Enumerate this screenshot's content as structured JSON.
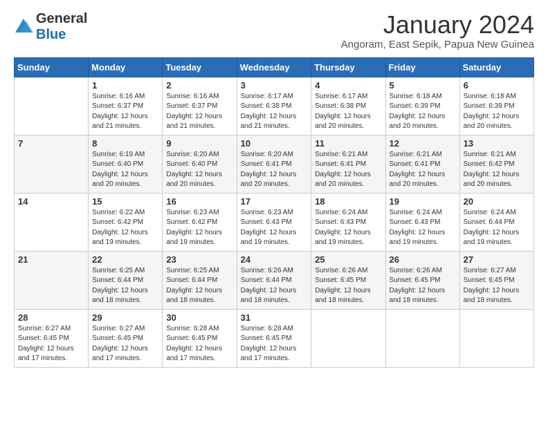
{
  "header": {
    "logo_general": "General",
    "logo_blue": "Blue",
    "main_title": "January 2024",
    "subtitle": "Angoram, East Sepik, Papua New Guinea"
  },
  "calendar": {
    "days_of_week": [
      "Sunday",
      "Monday",
      "Tuesday",
      "Wednesday",
      "Thursday",
      "Friday",
      "Saturday"
    ],
    "weeks": [
      [
        {
          "day": "",
          "info": ""
        },
        {
          "day": "1",
          "info": "Sunrise: 6:16 AM\nSunset: 6:37 PM\nDaylight: 12 hours\nand 21 minutes."
        },
        {
          "day": "2",
          "info": "Sunrise: 6:16 AM\nSunset: 6:37 PM\nDaylight: 12 hours\nand 21 minutes."
        },
        {
          "day": "3",
          "info": "Sunrise: 6:17 AM\nSunset: 6:38 PM\nDaylight: 12 hours\nand 21 minutes."
        },
        {
          "day": "4",
          "info": "Sunrise: 6:17 AM\nSunset: 6:38 PM\nDaylight: 12 hours\nand 20 minutes."
        },
        {
          "day": "5",
          "info": "Sunrise: 6:18 AM\nSunset: 6:39 PM\nDaylight: 12 hours\nand 20 minutes."
        },
        {
          "day": "6",
          "info": "Sunrise: 6:18 AM\nSunset: 6:39 PM\nDaylight: 12 hours\nand 20 minutes."
        }
      ],
      [
        {
          "day": "7",
          "info": ""
        },
        {
          "day": "8",
          "info": "Sunrise: 6:19 AM\nSunset: 6:40 PM\nDaylight: 12 hours\nand 20 minutes."
        },
        {
          "day": "9",
          "info": "Sunrise: 6:20 AM\nSunset: 6:40 PM\nDaylight: 12 hours\nand 20 minutes."
        },
        {
          "day": "10",
          "info": "Sunrise: 6:20 AM\nSunset: 6:41 PM\nDaylight: 12 hours\nand 20 minutes."
        },
        {
          "day": "11",
          "info": "Sunrise: 6:21 AM\nSunset: 6:41 PM\nDaylight: 12 hours\nand 20 minutes."
        },
        {
          "day": "12",
          "info": "Sunrise: 6:21 AM\nSunset: 6:41 PM\nDaylight: 12 hours\nand 20 minutes."
        },
        {
          "day": "13",
          "info": "Sunrise: 6:21 AM\nSunset: 6:42 PM\nDaylight: 12 hours\nand 20 minutes."
        }
      ],
      [
        {
          "day": "14",
          "info": ""
        },
        {
          "day": "15",
          "info": "Sunrise: 6:22 AM\nSunset: 6:42 PM\nDaylight: 12 hours\nand 19 minutes."
        },
        {
          "day": "16",
          "info": "Sunrise: 6:23 AM\nSunset: 6:42 PM\nDaylight: 12 hours\nand 19 minutes."
        },
        {
          "day": "17",
          "info": "Sunrise: 6:23 AM\nSunset: 6:43 PM\nDaylight: 12 hours\nand 19 minutes."
        },
        {
          "day": "18",
          "info": "Sunrise: 6:24 AM\nSunset: 6:43 PM\nDaylight: 12 hours\nand 19 minutes."
        },
        {
          "day": "19",
          "info": "Sunrise: 6:24 AM\nSunset: 6:43 PM\nDaylight: 12 hours\nand 19 minutes."
        },
        {
          "day": "20",
          "info": "Sunrise: 6:24 AM\nSunset: 6:44 PM\nDaylight: 12 hours\nand 19 minutes."
        }
      ],
      [
        {
          "day": "21",
          "info": ""
        },
        {
          "day": "22",
          "info": "Sunrise: 6:25 AM\nSunset: 6:44 PM\nDaylight: 12 hours\nand 18 minutes."
        },
        {
          "day": "23",
          "info": "Sunrise: 6:25 AM\nSunset: 6:44 PM\nDaylight: 12 hours\nand 18 minutes."
        },
        {
          "day": "24",
          "info": "Sunrise: 6:26 AM\nSunset: 6:44 PM\nDaylight: 12 hours\nand 18 minutes."
        },
        {
          "day": "25",
          "info": "Sunrise: 6:26 AM\nSunset: 6:45 PM\nDaylight: 12 hours\nand 18 minutes."
        },
        {
          "day": "26",
          "info": "Sunrise: 6:26 AM\nSunset: 6:45 PM\nDaylight: 12 hours\nand 18 minutes."
        },
        {
          "day": "27",
          "info": "Sunrise: 6:27 AM\nSunset: 6:45 PM\nDaylight: 12 hours\nand 18 minutes."
        }
      ],
      [
        {
          "day": "28",
          "info": "Sunrise: 6:27 AM\nSunset: 6:45 PM\nDaylight: 12 hours\nand 17 minutes."
        },
        {
          "day": "29",
          "info": "Sunrise: 6:27 AM\nSunset: 6:45 PM\nDaylight: 12 hours\nand 17 minutes."
        },
        {
          "day": "30",
          "info": "Sunrise: 6:28 AM\nSunset: 6:45 PM\nDaylight: 12 hours\nand 17 minutes."
        },
        {
          "day": "31",
          "info": "Sunrise: 6:28 AM\nSunset: 6:45 PM\nDaylight: 12 hours\nand 17 minutes."
        },
        {
          "day": "",
          "info": ""
        },
        {
          "day": "",
          "info": ""
        },
        {
          "day": "",
          "info": ""
        }
      ]
    ]
  }
}
